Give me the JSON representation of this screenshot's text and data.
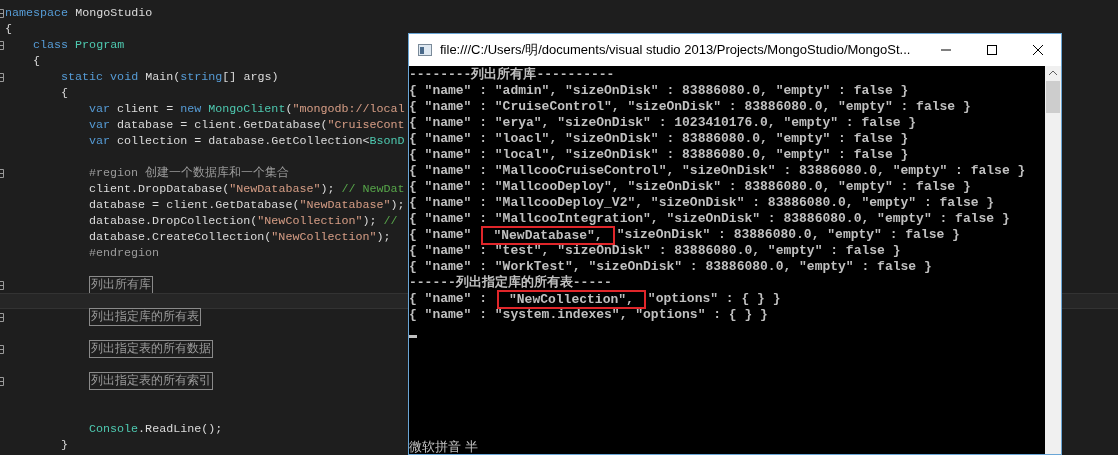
{
  "editor": {
    "lines": [
      {
        "fold": true,
        "tokens": [
          {
            "kind": "keyword",
            "text": "namespace "
          },
          {
            "kind": "plain",
            "text": "MongoStudio"
          }
        ]
      },
      {
        "fold": false,
        "tokens": [
          {
            "kind": "plain",
            "text": "{"
          }
        ],
        "children": [
          {
            "fold": true,
            "tokens": [
              {
                "kind": "keyword",
                "text": "class "
              },
              {
                "kind": "type",
                "text": "Program"
              }
            ]
          },
          {
            "fold": false,
            "tokens": [
              {
                "kind": "plain",
                "text": "{"
              }
            ],
            "children": [
              {
                "fold": true,
                "tokens": [
                  {
                    "kind": "keyword",
                    "text": "static "
                  },
                  {
                    "kind": "keyword",
                    "text": "void "
                  },
                  {
                    "kind": "plain",
                    "text": "Main("
                  },
                  {
                    "kind": "keyword",
                    "text": "string"
                  },
                  {
                    "kind": "plain",
                    "text": "[] args)"
                  }
                ]
              },
              {
                "fold": false,
                "tokens": [
                  {
                    "kind": "plain",
                    "text": "{"
                  }
                ],
                "children": [
                  {
                    "fold": false,
                    "tokens": [
                      {
                        "kind": "keyword",
                        "text": "var "
                      },
                      {
                        "kind": "plain",
                        "text": "client = "
                      },
                      {
                        "kind": "keyword",
                        "text": "new "
                      },
                      {
                        "kind": "type",
                        "text": "MongoClient"
                      },
                      {
                        "kind": "plain",
                        "text": "("
                      },
                      {
                        "kind": "string",
                        "text": "\"mongodb://local"
                      }
                    ]
                  },
                  {
                    "fold": false,
                    "tokens": [
                      {
                        "kind": "keyword",
                        "text": "var "
                      },
                      {
                        "kind": "plain",
                        "text": "database = client.GetDatabase("
                      },
                      {
                        "kind": "string",
                        "text": "\"CruiseCont"
                      }
                    ]
                  },
                  {
                    "fold": false,
                    "tokens": [
                      {
                        "kind": "keyword",
                        "text": "var "
                      },
                      {
                        "kind": "plain",
                        "text": "collection = database.GetCollection<"
                      },
                      {
                        "kind": "type",
                        "text": "BsonD"
                      }
                    ]
                  },
                  {
                    "fold": false
                  },
                  {
                    "fold": true,
                    "tokens": [
                      {
                        "kind": "directive",
                        "text": "#region 创建一个数据库和一个集合"
                      }
                    ]
                  },
                  {
                    "fold": false,
                    "tokens": [
                      {
                        "kind": "plain",
                        "text": "client.DropDatabase("
                      },
                      {
                        "kind": "string",
                        "text": "\"NewDatabase\""
                      },
                      {
                        "kind": "plain",
                        "text": "); "
                      },
                      {
                        "kind": "comment",
                        "text": "// NewDat"
                      }
                    ]
                  },
                  {
                    "fold": false,
                    "tokens": [
                      {
                        "kind": "plain",
                        "text": "database = client.GetDatabase("
                      },
                      {
                        "kind": "string",
                        "text": "\"NewDatabase\""
                      },
                      {
                        "kind": "plain",
                        "text": ");"
                      }
                    ]
                  },
                  {
                    "fold": false,
                    "tokens": [
                      {
                        "kind": "plain",
                        "text": "database.DropCollection("
                      },
                      {
                        "kind": "string",
                        "text": "\"NewCollection\""
                      },
                      {
                        "kind": "plain",
                        "text": "); "
                      },
                      {
                        "kind": "comment",
                        "text": "//"
                      }
                    ]
                  },
                  {
                    "fold": false,
                    "tokens": [
                      {
                        "kind": "plain",
                        "text": "database.CreateCollection("
                      },
                      {
                        "kind": "string",
                        "text": "\"NewCollection\""
                      },
                      {
                        "kind": "plain",
                        "text": ");"
                      }
                    ]
                  },
                  {
                    "fold": false,
                    "tokens": [
                      {
                        "kind": "directive",
                        "text": "#endregion"
                      }
                    ]
                  },
                  {
                    "fold": false
                  },
                  {
                    "fold": true,
                    "tokens": [
                      {
                        "kind": "collapsed",
                        "text": "列出所有库"
                      }
                    ]
                  },
                  {
                    "fold": false,
                    "current": true
                  },
                  {
                    "fold": true,
                    "tokens": [
                      {
                        "kind": "collapsed",
                        "text": "列出指定库的所有表"
                      }
                    ]
                  },
                  {
                    "fold": false
                  },
                  {
                    "fold": true,
                    "tokens": [
                      {
                        "kind": "collapsed",
                        "text": "列出指定表的所有数据"
                      }
                    ]
                  },
                  {
                    "fold": false
                  },
                  {
                    "fold": true,
                    "tokens": [
                      {
                        "kind": "collapsed",
                        "text": "列出指定表的所有索引"
                      }
                    ]
                  },
                  {
                    "fold": false
                  },
                  {
                    "fold": false
                  },
                  {
                    "fold": false,
                    "tokens": [
                      {
                        "kind": "type",
                        "text": "Console"
                      },
                      {
                        "kind": "plain",
                        "text": ".ReadLine();"
                      }
                    ]
                  }
                ]
              },
              {
                "fold": false,
                "tokens": [
                  {
                    "kind": "plain",
                    "text": "}"
                  }
                ]
              }
            ]
          }
        ]
      }
    ]
  },
  "console": {
    "title": "file:///C:/Users/明/documents/visual studio 2013/Projects/MongoStudio/MongoSt...",
    "lines": [
      {
        "parts": [
          {
            "text": "--------列出所有库----------",
            "highlighted": false
          }
        ]
      },
      {
        "parts": [
          {
            "text": "{ \"name\" : \"admin\", \"sizeOnDisk\" : 83886080.0, \"empty\" : false }",
            "highlighted": false
          }
        ]
      },
      {
        "parts": [
          {
            "text": "{ \"name\" : \"CruiseControl\", \"sizeOnDisk\" : 83886080.0, \"empty\" : false }",
            "highlighted": false
          }
        ]
      },
      {
        "parts": [
          {
            "text": "{ \"name\" : \"erya\", \"sizeOnDisk\" : 1023410176.0, \"empty\" : false }",
            "highlighted": false
          }
        ]
      },
      {
        "parts": [
          {
            "text": "{ \"name\" : \"loacl\", \"sizeOnDisk\" : 83886080.0, \"empty\" : false }",
            "highlighted": false
          }
        ]
      },
      {
        "parts": [
          {
            "text": "{ \"name\" : \"local\", \"sizeOnDisk\" : 83886080.0, \"empty\" : false }",
            "highlighted": false
          }
        ]
      },
      {
        "parts": [
          {
            "text": "{ \"name\" : \"MallcooCruiseControl\", \"sizeOnDisk\" : 83886080.0, \"empty\" : false }",
            "highlighted": false
          }
        ]
      },
      {
        "parts": [
          {
            "text": "{ \"name\" : \"MallcooDeploy\", \"sizeOnDisk\" : 83886080.0, \"empty\" : false }",
            "highlighted": false
          }
        ]
      },
      {
        "parts": [
          {
            "text": "{ \"name\" : \"MallcooDeploy_V2\", \"sizeOnDisk\" : 83886080.0, \"empty\" : false }",
            "highlighted": false
          }
        ]
      },
      {
        "parts": [
          {
            "text": "{ \"name\" : \"MallcooIntegration\", \"sizeOnDisk\" : 83886080.0, \"empty\" : false }",
            "highlighted": false
          }
        ]
      },
      {
        "parts": [
          {
            "text": "{ \"name\"",
            "highlighted": false
          },
          {
            "text": "\"NewDatabase\",",
            "highlighted": true
          },
          {
            "text": "\"sizeOnDisk\" : 83886080.0, \"empty\" : false }",
            "highlighted": false
          }
        ]
      },
      {
        "parts": [
          {
            "text": "{ \"name\" : \"test\", \"sizeOnDisk\" : 83886080.0, \"empty\" : false }",
            "highlighted": false
          }
        ]
      },
      {
        "parts": [
          {
            "text": "{ \"name\" : \"WorkTest\", \"sizeOnDisk\" : 83886080.0, \"empty\" : false }",
            "highlighted": false
          }
        ]
      },
      {
        "parts": [
          {
            "text": "------列出指定库的所有表-----",
            "highlighted": false
          }
        ]
      },
      {
        "parts": [
          {
            "text": "{ \"name\" :",
            "highlighted": false
          },
          {
            "text": "\"NewCollection\",",
            "highlighted": true
          },
          {
            "text": "\"options\" : { } }",
            "highlighted": false
          }
        ]
      },
      {
        "parts": [
          {
            "text": "{ \"name\" : \"system.indexes\", \"options\" : { } }",
            "highlighted": false
          }
        ]
      }
    ],
    "ime_status": "微软拼音 半"
  }
}
